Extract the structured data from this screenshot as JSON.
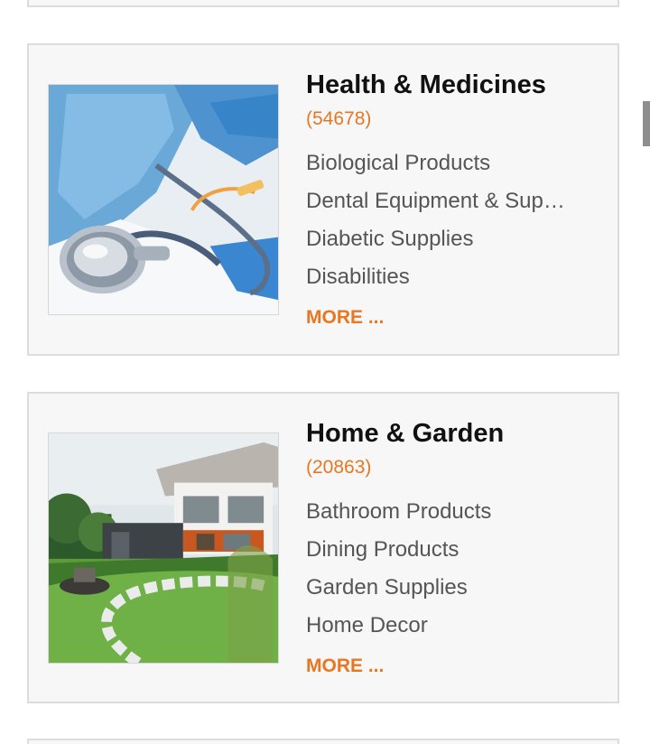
{
  "categories": [
    {
      "title": "Health & Medicines",
      "count": "(54678)",
      "image_icon": "medical-stethoscope-image",
      "subcategories": [
        "Biological Products",
        "Dental Equipment & Supplies",
        "Diabetic Supplies",
        "Disabilities"
      ],
      "more_label": "MORE ..."
    },
    {
      "title": "Home & Garden",
      "count": "(20863)",
      "image_icon": "house-garden-image",
      "subcategories": [
        "Bathroom Products",
        "Dining Products",
        "Garden Supplies",
        "Home Decor"
      ],
      "more_label": "MORE ..."
    }
  ],
  "colors": {
    "accent": "#e87722",
    "title": "#111111",
    "subcategory_text": "#555555",
    "card_background": "#f7f7f7",
    "card_border": "#dcdcdc"
  }
}
